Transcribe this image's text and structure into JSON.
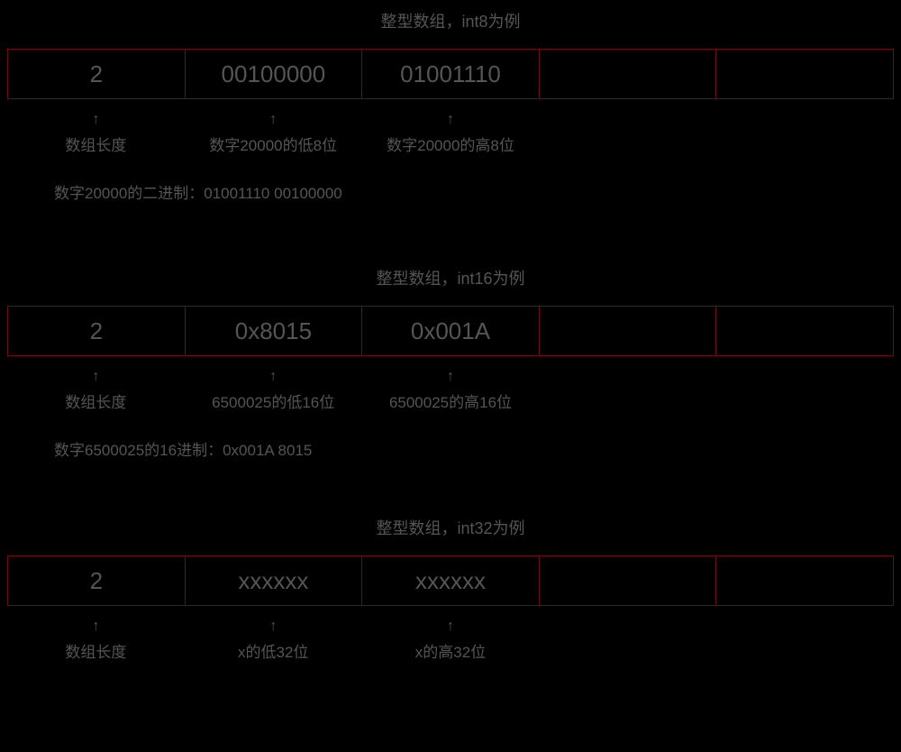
{
  "sections": [
    {
      "title": "整型数组，int8为例",
      "cells": [
        "2",
        "00100000",
        "01001110",
        "",
        ""
      ],
      "annots": [
        "数组长度",
        "数字20000的低8位",
        "数字20000的高8位",
        null,
        null
      ],
      "explain": "数字20000的二进制：01001110 00100000"
    },
    {
      "title": "整型数组，int16为例",
      "cells": [
        "2",
        "0x8015",
        "0x001A",
        "",
        ""
      ],
      "annots": [
        "数组长度",
        "6500025的低16位",
        "6500025的高16位",
        null,
        null
      ],
      "explain": "数字6500025的16进制：0x001A 8015"
    },
    {
      "title": "整型数组，int32为例",
      "cells": [
        "2",
        "xxxxxx",
        "xxxxxx",
        "",
        ""
      ],
      "annots": [
        "数组长度",
        "x的低32位",
        "x的高32位",
        null,
        null
      ],
      "explain": null
    }
  ]
}
